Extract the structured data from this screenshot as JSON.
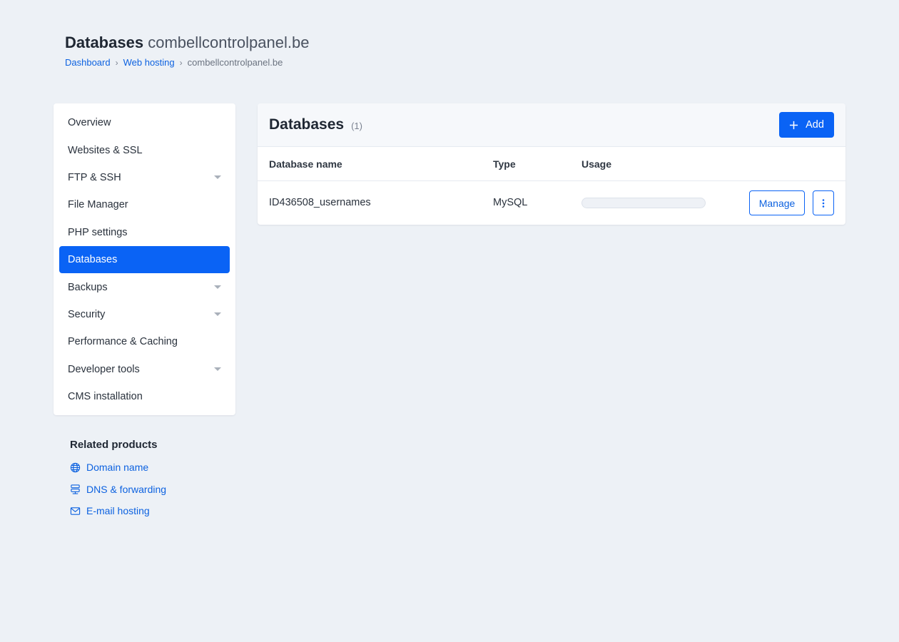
{
  "header": {
    "title_bold": "Databases",
    "title_light": "combellcontrolpanel.be",
    "breadcrumb": [
      "Dashboard",
      "Web hosting",
      "combellcontrolpanel.be"
    ]
  },
  "sidebar": {
    "items": [
      {
        "label": "Overview",
        "expandable": false
      },
      {
        "label": "Websites & SSL",
        "expandable": false
      },
      {
        "label": "FTP & SSH",
        "expandable": true
      },
      {
        "label": "File Manager",
        "expandable": false
      },
      {
        "label": "PHP settings",
        "expandable": false
      },
      {
        "label": "Databases",
        "expandable": false,
        "active": true
      },
      {
        "label": "Backups",
        "expandable": true
      },
      {
        "label": "Security",
        "expandable": true
      },
      {
        "label": "Performance & Caching",
        "expandable": false
      },
      {
        "label": "Developer tools",
        "expandable": true
      },
      {
        "label": "CMS installation",
        "expandable": false
      }
    ]
  },
  "related": {
    "title": "Related products",
    "links": [
      {
        "label": "Domain name",
        "icon": "globe-icon"
      },
      {
        "label": "DNS & forwarding",
        "icon": "dns-server-icon"
      },
      {
        "label": "E-mail hosting",
        "icon": "envelope-icon"
      }
    ]
  },
  "panel": {
    "title": "Databases",
    "count": "(1)",
    "add_label": "Add",
    "columns": [
      "Database name",
      "Type",
      "Usage"
    ],
    "rows": [
      {
        "name": "ID436508_usernames",
        "type": "MySQL",
        "usage": 0,
        "manage_label": "Manage"
      }
    ]
  },
  "colors": {
    "accent": "#0a63f5",
    "link": "#0d62e0",
    "background": "#edf1f6"
  }
}
